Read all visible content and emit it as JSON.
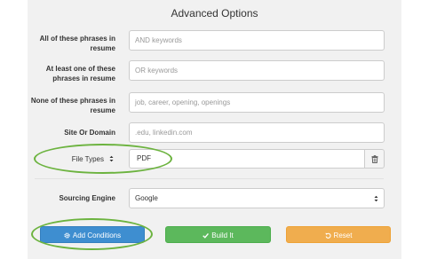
{
  "title": "Advanced Options",
  "rows": {
    "all_phrases": {
      "label": "All of these phrases in resume",
      "placeholder": "AND keywords"
    },
    "one_phrase": {
      "label": "At least one of these phrases in resume",
      "placeholder": "OR keywords"
    },
    "none_phrases": {
      "label": "None of these phrases in resume",
      "placeholder": "job, career, opening, openings"
    },
    "site": {
      "label": "Site Or Domain",
      "placeholder": ".edu, linkedin.com"
    }
  },
  "file_types": {
    "label": "File Types",
    "value": "PDF"
  },
  "sourcing_engine": {
    "label": "Sourcing Engine",
    "value": "Google"
  },
  "buttons": {
    "add_conditions": "Add Conditions",
    "build_it": "Build It",
    "reset": "Reset"
  },
  "colors": {
    "primary": "#3e8ed0",
    "success": "#5cb85c",
    "warning": "#f0ad4e",
    "highlight": "#6cb33f"
  }
}
